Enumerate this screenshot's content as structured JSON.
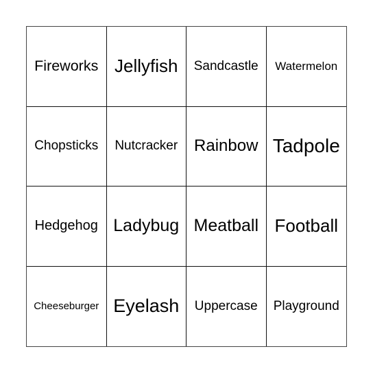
{
  "board": {
    "rows": [
      [
        "Fireworks",
        "Jellyfish",
        "Sandcastle",
        "Watermelon"
      ],
      [
        "Chopsticks",
        "Nutcracker",
        "Rainbow",
        "Tadpole"
      ],
      [
        "Hedgehog",
        "Ladybug",
        "Meatball",
        "Football"
      ],
      [
        "Cheeseburger",
        "Eyelash",
        "Uppercase",
        "Playground"
      ]
    ]
  },
  "colors": {
    "background": "#ffffff",
    "grid_line": "#111111",
    "text": "#000000"
  }
}
